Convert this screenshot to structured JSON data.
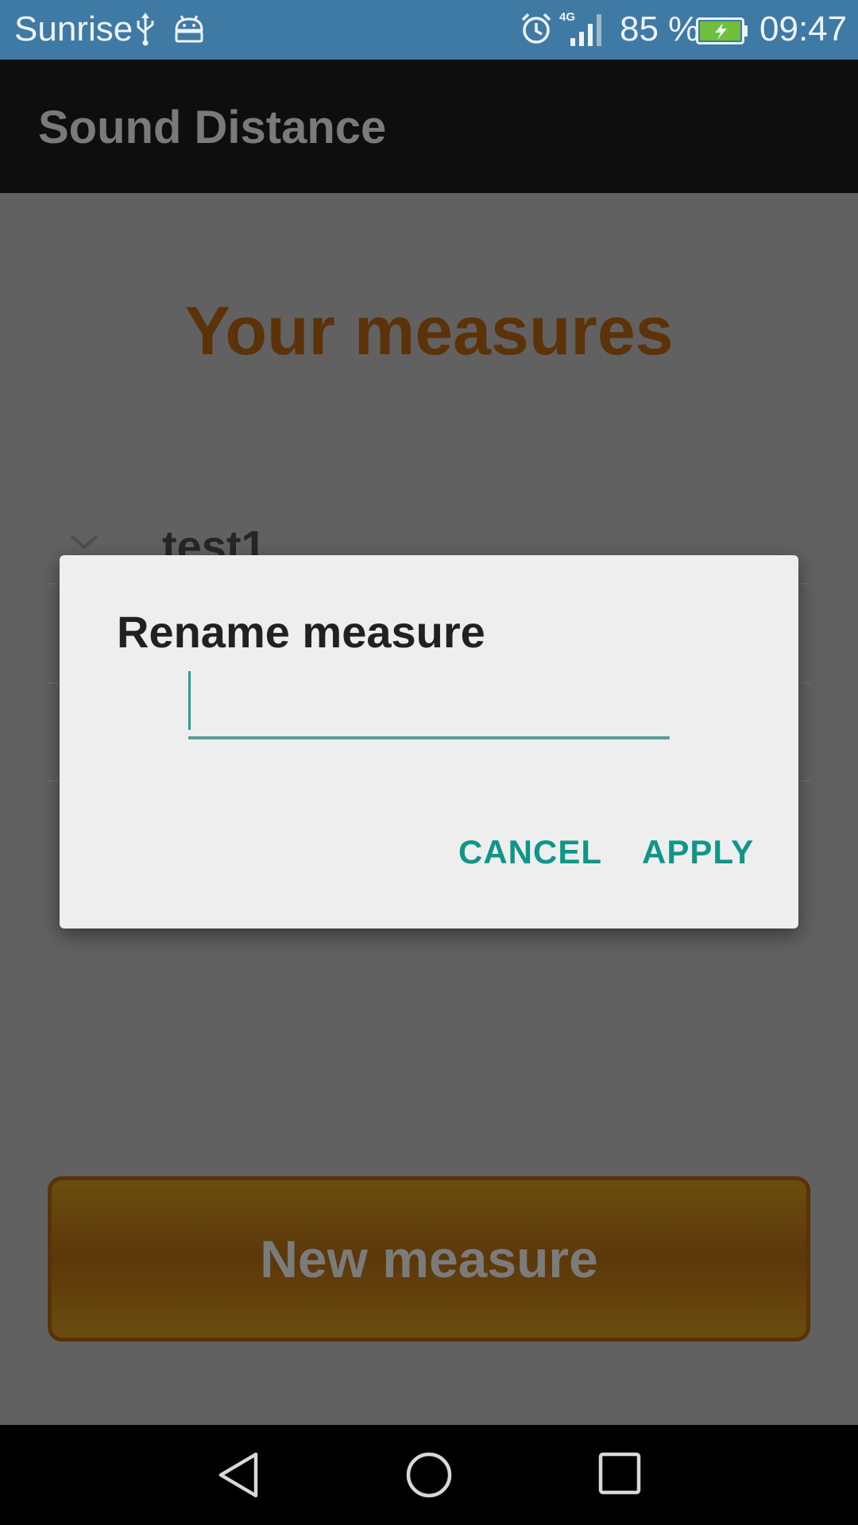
{
  "status_bar": {
    "carrier": "Sunrise",
    "network": "4G",
    "battery_percent": "85 %",
    "time": "09:47",
    "icons": [
      "usb-icon",
      "android-debug-icon",
      "alarm-icon",
      "signal-icon",
      "battery-charging-icon"
    ]
  },
  "app_bar": {
    "title": "Sound Distance"
  },
  "main": {
    "heading": "Your measures",
    "measures": [
      {
        "name": "test1"
      }
    ],
    "new_measure_label": "New measure"
  },
  "dialog": {
    "title": "Rename measure",
    "input_value": "",
    "cancel_label": "CANCEL",
    "apply_label": "APPLY"
  },
  "nav_bar": {
    "icons": [
      "back-icon",
      "home-icon",
      "recents-icon"
    ]
  },
  "colors": {
    "status_bar": "#3f7aa4",
    "accent": "#0f9688",
    "heading": "#5c3209",
    "button": "#6a4d0e"
  }
}
